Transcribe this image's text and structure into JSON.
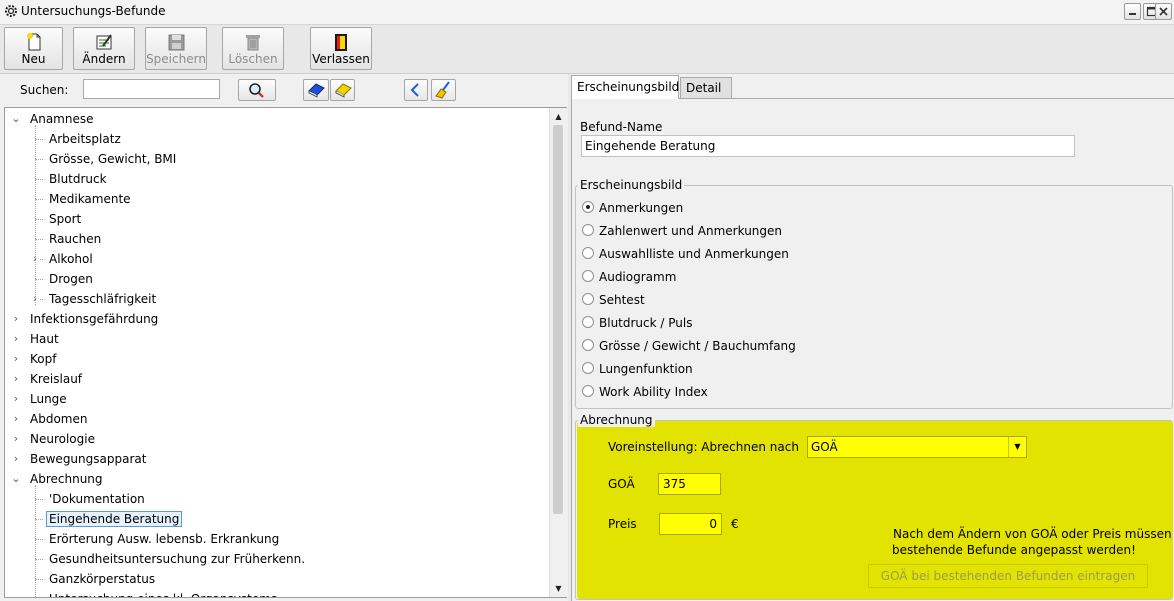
{
  "window": {
    "title": "Untersuchungs-Befunde"
  },
  "toolbar": {
    "new_label": "Neu",
    "edit_label": "Ändern",
    "save_label": "Speichern",
    "delete_label": "Löschen",
    "exit_label": "Verlassen"
  },
  "search": {
    "label": "Suchen:",
    "value": ""
  },
  "tree": [
    {
      "label": "Anamnese",
      "level": 0,
      "expanded": true
    },
    {
      "label": "Arbeitsplatz",
      "level": 1
    },
    {
      "label": "Grösse, Gewicht, BMI",
      "level": 1
    },
    {
      "label": "Blutdruck",
      "level": 1
    },
    {
      "label": "Medikamente",
      "level": 1
    },
    {
      "label": "Sport",
      "level": 1
    },
    {
      "label": "Rauchen",
      "level": 1
    },
    {
      "label": "Alkohol",
      "level": 1,
      "expandable": true
    },
    {
      "label": "Drogen",
      "level": 1
    },
    {
      "label": "Tagesschläfrigkeit",
      "level": 1,
      "expandable": true
    },
    {
      "label": "Infektionsgefährdung",
      "level": 0,
      "expandable": true
    },
    {
      "label": "Haut",
      "level": 0,
      "expandable": true
    },
    {
      "label": "Kopf",
      "level": 0,
      "expandable": true
    },
    {
      "label": "Kreislauf",
      "level": 0,
      "expandable": true
    },
    {
      "label": "Lunge",
      "level": 0,
      "expandable": true
    },
    {
      "label": "Abdomen",
      "level": 0,
      "expandable": true
    },
    {
      "label": "Neurologie",
      "level": 0,
      "expandable": true
    },
    {
      "label": "Bewegungsapparat",
      "level": 0,
      "expandable": true
    },
    {
      "label": "Abrechnung",
      "level": 0,
      "expanded": true
    },
    {
      "label": "'Dokumentation",
      "level": 1
    },
    {
      "label": "Eingehende Beratung",
      "level": 1,
      "selected": true
    },
    {
      "label": "Erörterung Ausw. lebensb. Erkrankung",
      "level": 1
    },
    {
      "label": "Gesundheitsuntersuchung zur Früherkenn.",
      "level": 1
    },
    {
      "label": "Ganzkörperstatus",
      "level": 1
    },
    {
      "label": "Untersuchung eines kl. Organsystems",
      "level": 1
    }
  ],
  "tabs": {
    "erscheinungsbild": "Erscheinungsbild",
    "detail": "Detail"
  },
  "form": {
    "befund_name_label": "Befund-Name",
    "befund_name_value": "Eingehende Beratung",
    "erscheinungsbild_group_label": "Erscheinungsbild",
    "options": [
      {
        "label": "Anmerkungen",
        "checked": true
      },
      {
        "label": "Zahlenwert und Anmerkungen",
        "checked": false
      },
      {
        "label": "Auswahlliste und Anmerkungen",
        "checked": false
      },
      {
        "label": "Audiogramm",
        "checked": false
      },
      {
        "label": "Sehtest",
        "checked": false
      },
      {
        "label": "Blutdruck / Puls",
        "checked": false
      },
      {
        "label": "Grösse / Gewicht / Bauchumfang",
        "checked": false
      },
      {
        "label": "Lungenfunktion",
        "checked": false
      },
      {
        "label": "Work Ability Index",
        "checked": false
      }
    ]
  },
  "abrechnung": {
    "group_label": "Abrechnung",
    "voreinstellung_label": "Voreinstellung: Abrechnen nach",
    "voreinstellung_value": "GOÄ",
    "goae_label": "GOÄ",
    "goae_value": "375",
    "preis_label": "Preis",
    "preis_value": "0",
    "currency": "€",
    "hint_line1": "Nach dem Ändern von GOÄ oder Preis müssen",
    "hint_line2": "bestehende Befunde angepasst werden!",
    "apply_button": "GOÄ bei bestehenden Befunden eintragen"
  },
  "colors": {
    "highlight_yellow": "#e3e300",
    "input_yellow": "#ffff00",
    "selection_border": "#5b9bd5"
  }
}
